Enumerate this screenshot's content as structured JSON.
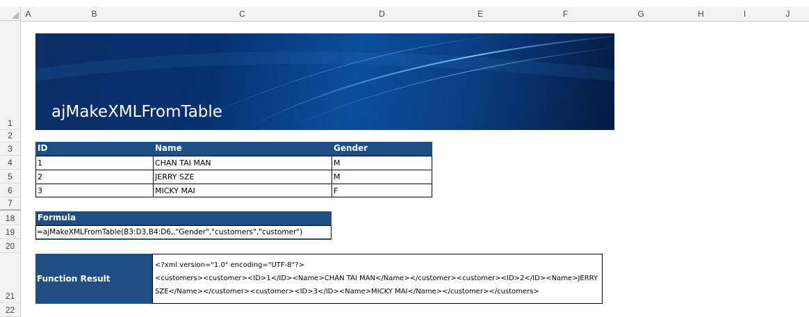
{
  "columns": [
    "A",
    "B",
    "C",
    "D",
    "E",
    "F",
    "G",
    "H",
    "I",
    "J"
  ],
  "rows": [
    "1",
    "2",
    "3",
    "4",
    "5",
    "6",
    "7",
    "18",
    "19",
    "20",
    "21",
    "22"
  ],
  "banner": {
    "title": "ajMakeXMLFromTable"
  },
  "table": {
    "headers": [
      "ID",
      "Name",
      "Gender"
    ],
    "rows": [
      [
        "1",
        "CHAN TAI MAN",
        "M"
      ],
      [
        "2",
        "JERRY SZE",
        "M"
      ],
      [
        "3",
        "MICKY MAI",
        "F"
      ]
    ]
  },
  "formula": {
    "header": "Formula",
    "value": "=ajMakeXMLFromTable(B3:D3,B4:D6,,\"Gender\",\"customers\",\"customer\")"
  },
  "result": {
    "label": "Function Result",
    "line1": "<?xml version=\"1.0\" encoding=\"UTF-8\"?>",
    "line2": "<customers><customer><ID>1</ID><Name>CHAN TAI MAN</Name></customer><customer><ID>2</ID><Name>JERRY",
    "line3": "SZE</Name></customer><customer><ID>3</ID><Name>MICKY MAI</Name></customer></customers>"
  },
  "colors": {
    "header_fill": "#1f4e84",
    "banner_dark": "#0b2f66"
  }
}
